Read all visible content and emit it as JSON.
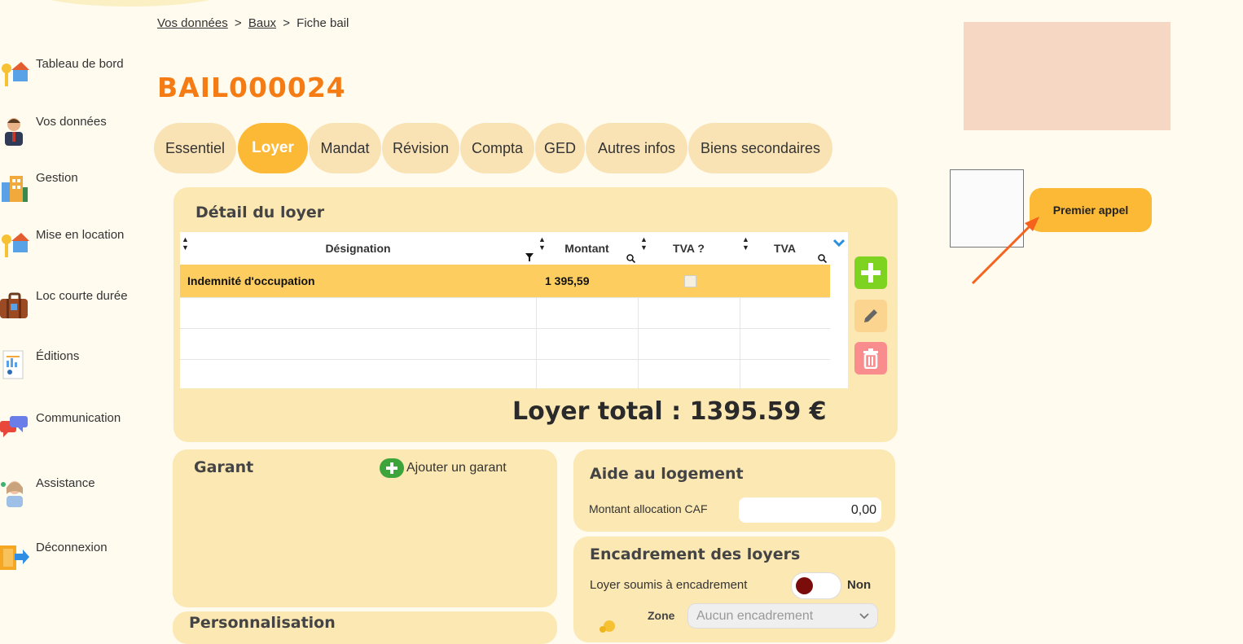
{
  "sidebar": {
    "items": [
      {
        "label": "Tableau de bord"
      },
      {
        "label": "Vos données"
      },
      {
        "label": "Gestion"
      },
      {
        "label": "Mise en location"
      },
      {
        "label": "Loc courte durée"
      },
      {
        "label": "Éditions"
      },
      {
        "label": "Communication"
      },
      {
        "label": "Assistance"
      },
      {
        "label": "Déconnexion"
      }
    ]
  },
  "breadcrumb": {
    "link1": "Vos données",
    "sep": ">",
    "link2": "Baux",
    "current": "Fiche bail"
  },
  "page": {
    "title": "BAIL000024"
  },
  "tabs": [
    {
      "label": "Essentiel"
    },
    {
      "label": "Loyer"
    },
    {
      "label": "Mandat"
    },
    {
      "label": "Révision"
    },
    {
      "label": "Compta"
    },
    {
      "label": "GED"
    },
    {
      "label": "Autres infos"
    },
    {
      "label": "Biens secondaires"
    }
  ],
  "colors": {
    "accent": "#fbb935",
    "title": "#f57c14",
    "card": "#fce8b3",
    "selected_row": "#fdcd5f"
  },
  "loyer": {
    "title": "Détail du loyer",
    "columns": [
      "Désignation",
      "Montant",
      "TVA ?",
      "TVA"
    ],
    "rows": [
      {
        "designation": "Indemnité d'occupation",
        "montant": "1 395,59",
        "tva_q": false,
        "tva": ""
      }
    ],
    "total": "Loyer total : 1395.59 €"
  },
  "garant": {
    "title": "Garant",
    "add_label": "Ajouter un garant"
  },
  "personnalisation": {
    "title": "Personnalisation"
  },
  "aide": {
    "title": "Aide au logement",
    "label": "Montant allocation CAF",
    "value": "0,00"
  },
  "encadrement": {
    "title": "Encadrement des loyers",
    "label": "Loyer soumis à encadrement",
    "toggle_value": "Non",
    "zone_label": "Zone",
    "zone_value": "Aucun encadrement"
  },
  "premier_appel": {
    "label": "Premier appel"
  }
}
